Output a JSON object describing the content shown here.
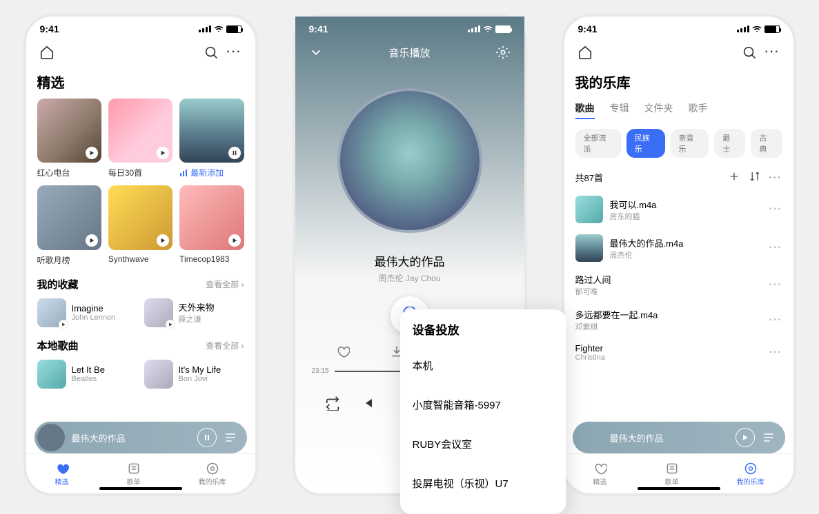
{
  "status": {
    "time": "9:41"
  },
  "home": {
    "title": "精选",
    "tiles": [
      {
        "label": "红心电台"
      },
      {
        "label": "每日30首"
      },
      {
        "label": "最新添加",
        "blue": true
      },
      {
        "label": "听歌月榜"
      },
      {
        "label": "Synthwave"
      },
      {
        "label": "Timecop1983"
      }
    ],
    "fav_head": "我的收藏",
    "more": "查看全部",
    "favs": [
      {
        "t": "Imagine",
        "a": "John Lennon"
      },
      {
        "t": "天外来物",
        "a": "薛之谦"
      }
    ],
    "local_head": "本地歌曲",
    "locals": [
      {
        "t": "Let It Be",
        "a": "Beatles"
      },
      {
        "t": "It's My Life",
        "a": "Bon Jovi"
      }
    ],
    "now_playing": "最伟大的作品",
    "tabs": [
      "精选",
      "歌单",
      "我的乐库"
    ]
  },
  "player": {
    "header": "音乐播放",
    "song": "最伟大的作品",
    "artist": "周杰伦 Jay Chou",
    "time": "23:15",
    "cast_title": "设备投放",
    "cast_items": [
      "本机",
      "小度智能音箱-5997",
      "RUBY会议室",
      "投屏电视（乐视）U7"
    ]
  },
  "library": {
    "title": "我的乐库",
    "tabs": [
      "歌曲",
      "专辑",
      "文件夹",
      "歌手"
    ],
    "chips": [
      "全部流派",
      "民族乐",
      "亲音乐",
      "爵士",
      "古典"
    ],
    "count": "共87首",
    "songs": [
      {
        "t": "我可以.m4a",
        "a": "房东的猫",
        "img": true
      },
      {
        "t": "最伟大的作品.m4a",
        "a": "周杰伦",
        "img": true
      },
      {
        "t": "路过人间",
        "a": "郁可唯"
      },
      {
        "t": "多远都要在一起.m4a",
        "a": "邓紫棋"
      },
      {
        "t": "Fighter",
        "a": "Christina"
      }
    ],
    "now_playing": "最伟大的作品"
  }
}
